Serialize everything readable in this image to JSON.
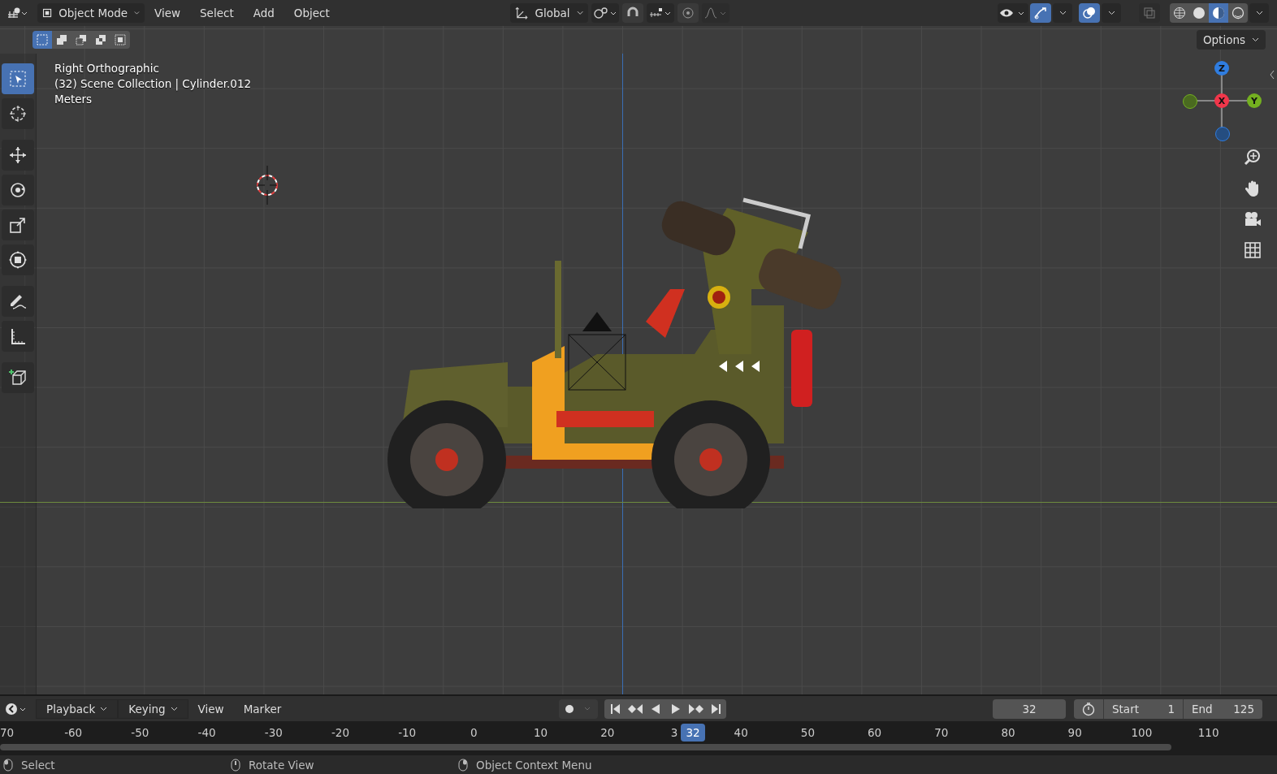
{
  "header": {
    "mode": "Object Mode",
    "menus": [
      "View",
      "Select",
      "Add",
      "Object"
    ],
    "orientation": "Global",
    "toggles": [
      {
        "kind": "snap",
        "on": false
      },
      {
        "kind": "proportional",
        "on": false
      },
      {
        "kind": "gizmo",
        "on": true
      },
      {
        "kind": "overlay",
        "on": true
      },
      {
        "kind": "xray",
        "on": false
      }
    ],
    "shading": [
      {
        "kind": "wire",
        "selected": false
      },
      {
        "kind": "solid",
        "selected": false
      },
      {
        "kind": "material",
        "selected": true
      },
      {
        "kind": "render",
        "selected": false
      }
    ]
  },
  "select_modes": [
    {
      "kind": "new",
      "selected": true
    },
    {
      "kind": "extend",
      "selected": false
    },
    {
      "kind": "subtract",
      "selected": false
    },
    {
      "kind": "invert",
      "selected": false
    },
    {
      "kind": "intersect",
      "selected": false
    }
  ],
  "options": "Options",
  "tools": [
    {
      "kind": "select",
      "selected": true
    },
    {
      "kind": "cursor",
      "selected": false
    },
    {
      "kind": "move",
      "selected": false
    },
    {
      "kind": "rotate",
      "selected": false
    },
    {
      "kind": "scale",
      "selected": false
    },
    {
      "kind": "transform",
      "selected": false
    },
    {
      "kind": "annotate",
      "selected": false
    },
    {
      "kind": "measure",
      "selected": false
    },
    {
      "kind": "add",
      "selected": false
    }
  ],
  "viewport_info": [
    "Right Orthographic",
    "(32) Scene Collection | Cylinder.012",
    "Meters"
  ],
  "gizmo": {
    "z": "Z",
    "x": "X",
    "y": "Y"
  },
  "timeline": {
    "menus": [
      {
        "label": "Playback",
        "dropdown": true
      },
      {
        "label": "Keying",
        "dropdown": true
      },
      {
        "label": "View",
        "dropdown": false
      },
      {
        "label": "Marker",
        "dropdown": false
      }
    ],
    "current_frame": "32",
    "start_label": "Start",
    "start": "1",
    "end_label": "End",
    "end": "125",
    "ticks": [
      "70",
      "-60",
      "-50",
      "-40",
      "-30",
      "-20",
      "-10",
      "0",
      "10",
      "20",
      "3",
      "40",
      "50",
      "60",
      "70",
      "80",
      "90",
      "100",
      "110"
    ],
    "playhead": "32"
  },
  "status_bar": [
    {
      "kind": "left",
      "label": "Select"
    },
    {
      "kind": "middle",
      "label": "Rotate View"
    },
    {
      "kind": "right",
      "label": "Object Context Menu"
    }
  ]
}
